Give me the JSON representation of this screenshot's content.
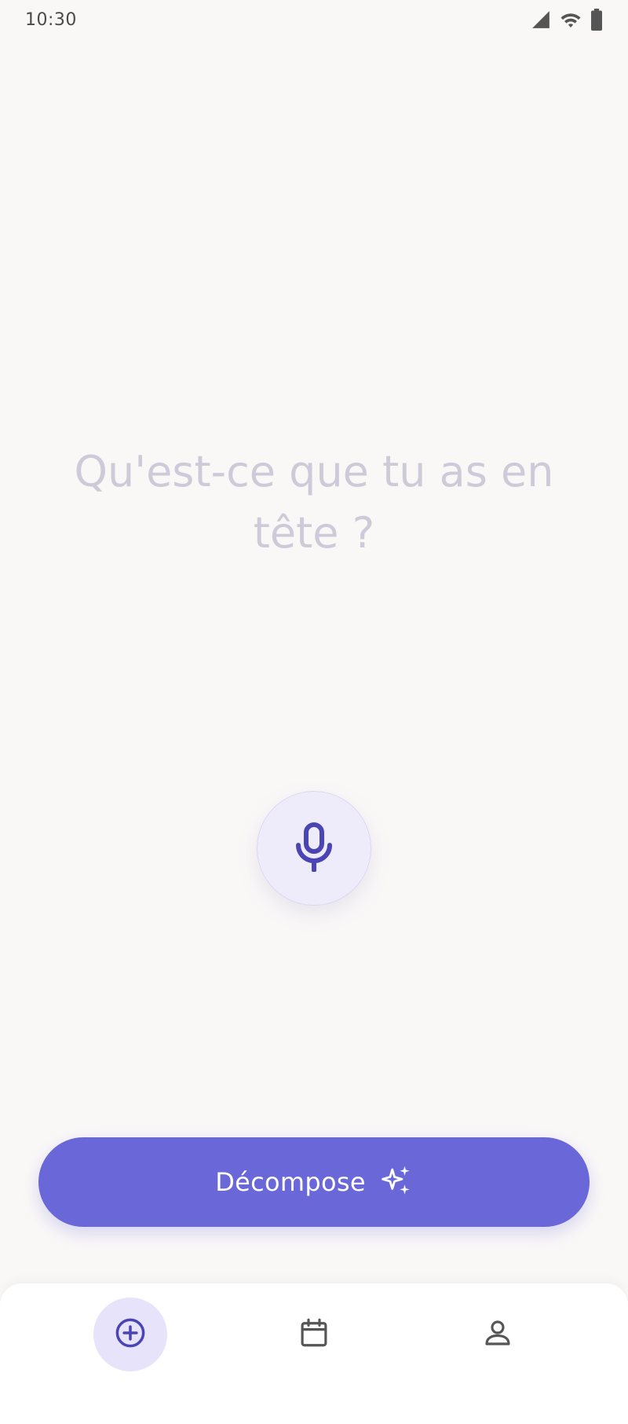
{
  "status_bar": {
    "time": "10:30",
    "icons": [
      "signal-icon",
      "wifi-icon",
      "battery-icon"
    ]
  },
  "prompt": {
    "line1": "Qu'est-ce que tu as en",
    "line2": "tête ?"
  },
  "mic": {
    "icon": "microphone-icon"
  },
  "decompose": {
    "label": "Décompose",
    "icon": "sparkles-icon"
  },
  "bottom_nav": {
    "items": [
      {
        "icon": "add-circle-icon",
        "active": true
      },
      {
        "icon": "calendar-icon",
        "active": false
      },
      {
        "icon": "profile-icon",
        "active": false
      }
    ]
  },
  "colors": {
    "background": "#faf8f7",
    "accent": "#6a67d8",
    "accent_dark": "#4a44b5",
    "prompt_text": "#cdcbd8",
    "mic_bg": "#eeecfb",
    "nav_active_bg": "#e6e3fb"
  }
}
